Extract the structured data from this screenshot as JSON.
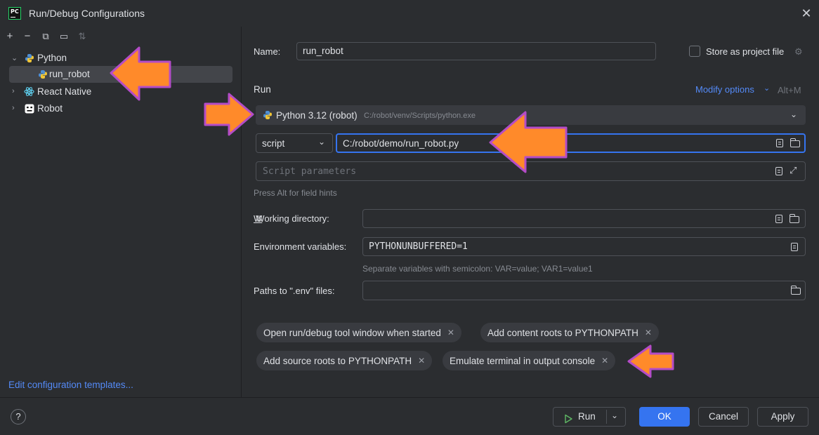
{
  "window": {
    "title": "Run/Debug Configurations"
  },
  "tree": {
    "items": [
      {
        "label": "Python"
      },
      {
        "label": "run_robot"
      },
      {
        "label": "React Native"
      },
      {
        "label": "Robot"
      }
    ],
    "edit_templates_link": "Edit configuration templates..."
  },
  "form": {
    "name_label": "Name:",
    "name_value": "run_robot",
    "store_label": "Store as project file",
    "run_section": "Run",
    "modify_options": "Modify options",
    "modify_shortcut": "Alt+M",
    "interpreter_name": "Python 3.12 (robot)",
    "interpreter_path": "C:/robot/venv/Scripts/python.exe",
    "run_type": "script",
    "script_path": "C:/robot/demo/run_robot.py",
    "script_params_placeholder": "Script parameters",
    "field_hint": "Press Alt for field hints",
    "working_dir_label": "Working directory:",
    "working_dir_value": "",
    "env_label": "Environment variables:",
    "env_value": "PYTHONUNBUFFERED=1",
    "env_hint": "Separate variables with semicolon: VAR=value; VAR1=value1",
    "dotenv_label": "Paths to \".env\" files:",
    "dotenv_value": ""
  },
  "chips": [
    "Open run/debug tool window when started",
    "Add content roots to PYTHONPATH",
    "Add source roots to PYTHONPATH",
    "Emulate terminal in output console"
  ],
  "footer": {
    "help": "?",
    "run": "Run",
    "ok": "OK",
    "cancel": "Cancel",
    "apply": "Apply"
  },
  "colors": {
    "accent": "#3574f0",
    "annotation_arrow": "#ff8a2a",
    "annotation_outline": "#b44cc7"
  }
}
